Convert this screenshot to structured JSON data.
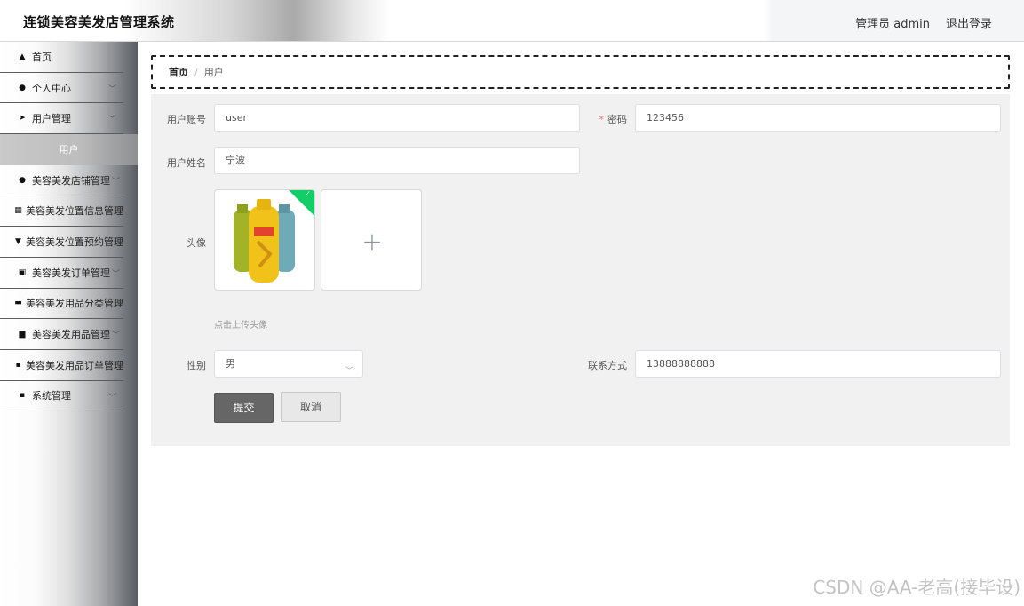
{
  "header": {
    "title": "连锁美容美发店管理系统",
    "user_label": "管理员 admin",
    "logout_label": "退出登录"
  },
  "sidebar": {
    "items": [
      {
        "label": "首页",
        "icon": "home-icon",
        "glyph": "⌂"
      },
      {
        "label": "个人中心",
        "icon": "user-icon",
        "glyph": "●"
      },
      {
        "label": "用户管理",
        "icon": "send-icon",
        "glyph": "➤"
      },
      {
        "label": "用户",
        "icon": "",
        "glyph": ""
      },
      {
        "label": "美容美发店铺管理",
        "icon": "pin-icon",
        "glyph": "●"
      },
      {
        "label": "美容美发位置信息管理",
        "icon": "grid-icon",
        "glyph": "▦"
      },
      {
        "label": "美容美发位置预约管理",
        "icon": "cup-icon",
        "glyph": "▼"
      },
      {
        "label": "美容美发订单管理",
        "icon": "clipboard-icon",
        "glyph": "▣"
      },
      {
        "label": "美容美发用品分类管理",
        "icon": "screen-icon",
        "glyph": "▬"
      },
      {
        "label": "美容美发用品管理",
        "icon": "briefcase-icon",
        "glyph": "▆"
      },
      {
        "label": "美容美发用品订单管理",
        "icon": "apps-icon",
        "glyph": "▪"
      },
      {
        "label": "系统管理",
        "icon": "apps-icon",
        "glyph": "▪"
      }
    ]
  },
  "breadcrumb": {
    "home": "首页",
    "separator": "/",
    "current": "用户"
  },
  "form": {
    "account_label": "用户账号",
    "account_value": "user",
    "password_label": "密码",
    "password_value": "123456",
    "name_label": "用户姓名",
    "name_value": "宁波",
    "avatar_label": "头像",
    "upload_tip": "点击上传头像",
    "gender_label": "性别",
    "gender_value": "男",
    "phone_label": "联系方式",
    "phone_value": "13888888888",
    "submit_label": "提交",
    "cancel_label": "取消"
  },
  "watermark": "CSDN @AA-老高(接毕设)"
}
